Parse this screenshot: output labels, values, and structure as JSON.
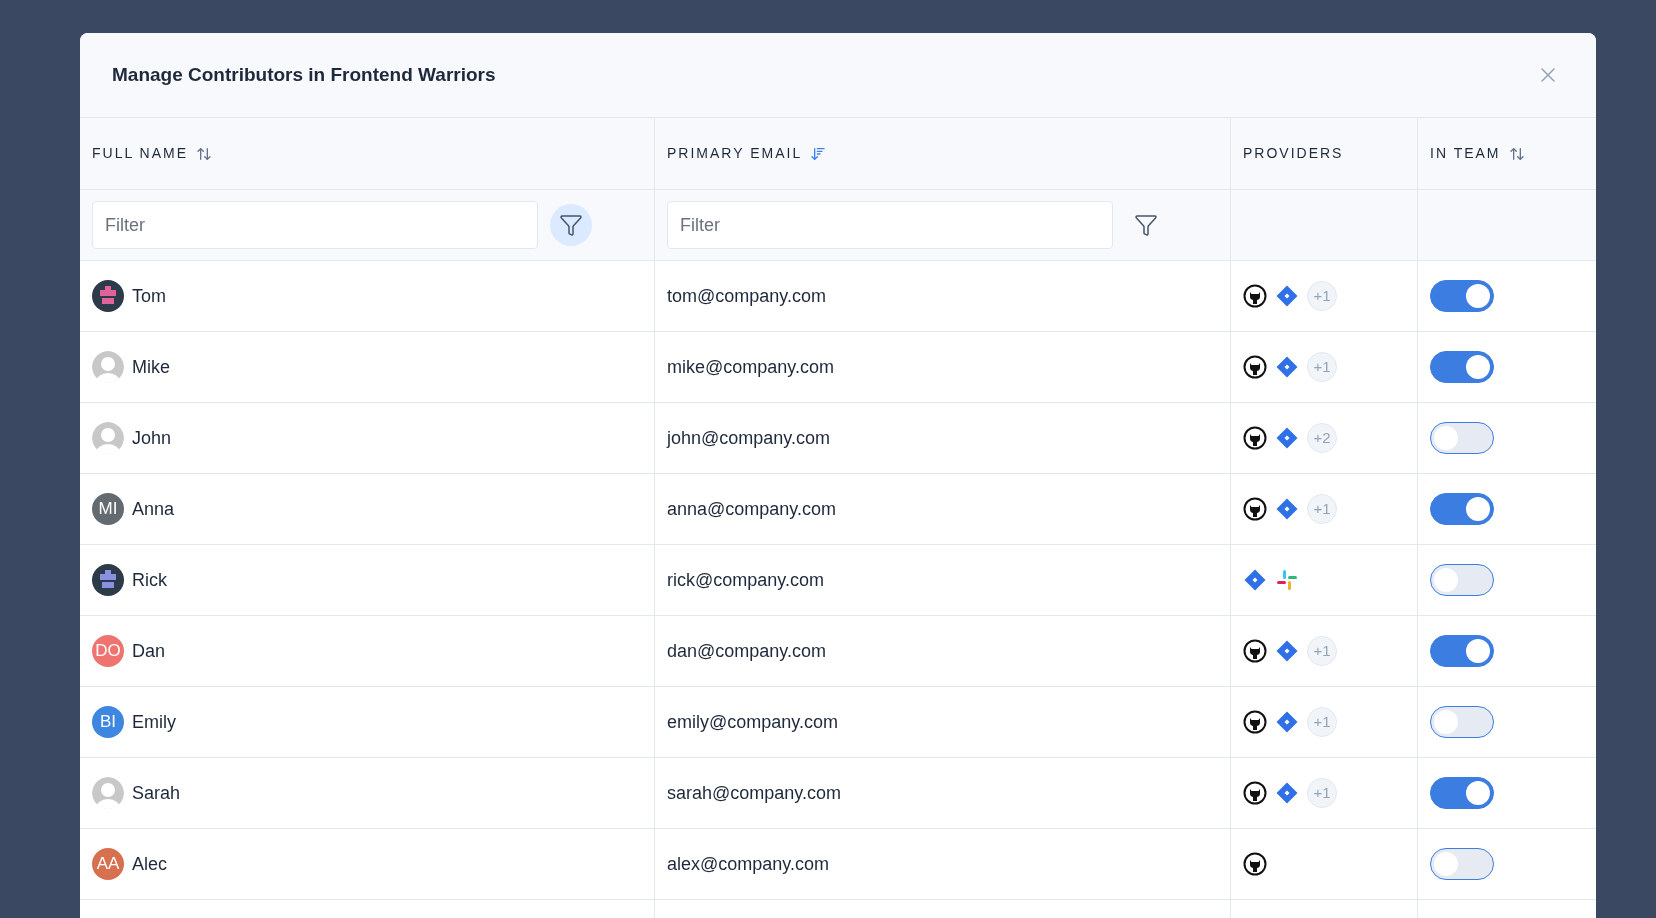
{
  "modal": {
    "title": "Manage Contributors in Frontend Warriors"
  },
  "columns": [
    {
      "label": "FULL NAME",
      "sort": {
        "kind": "unsorted"
      },
      "filter": {
        "placeholder": "Filter",
        "active": true
      }
    },
    {
      "label": "PRIMARY EMAIL",
      "sort": {
        "kind": "descending"
      },
      "filter": {
        "placeholder": "Filter",
        "active": false
      }
    },
    {
      "label": "PROVIDERS"
    },
    {
      "label": "IN TEAM",
      "sort": {
        "kind": "unsorted"
      }
    }
  ],
  "rows": [
    {
      "name": "Tom",
      "avatar": {
        "kind": "pixel",
        "color": "#e0649a"
      },
      "email": "tom@company.com",
      "providers": [
        {
          "kind": "github"
        },
        {
          "kind": "jira"
        }
      ],
      "more": "+1",
      "in_team": true
    },
    {
      "name": "Mike",
      "avatar": {
        "kind": "default"
      },
      "email": "mike@company.com",
      "providers": [
        {
          "kind": "github"
        },
        {
          "kind": "jira"
        }
      ],
      "more": "+1",
      "in_team": true
    },
    {
      "name": "John",
      "avatar": {
        "kind": "default"
      },
      "email": "john@company.com",
      "providers": [
        {
          "kind": "github"
        },
        {
          "kind": "jira"
        }
      ],
      "more": "+2",
      "in_team": false
    },
    {
      "name": "Anna",
      "avatar": {
        "kind": "initials",
        "initials": "MI",
        "color": "#646b70"
      },
      "email": "anna@company.com",
      "providers": [
        {
          "kind": "github"
        },
        {
          "kind": "jira"
        }
      ],
      "more": "+1",
      "in_team": true
    },
    {
      "name": "Rick",
      "avatar": {
        "kind": "pixel",
        "color": "#8b8fe0"
      },
      "email": "rick@company.com",
      "providers": [
        {
          "kind": "jira"
        },
        {
          "kind": "slack"
        }
      ],
      "in_team": false
    },
    {
      "name": "Dan",
      "avatar": {
        "kind": "initials",
        "initials": "DO",
        "color": "#ef7470"
      },
      "email": "dan@company.com",
      "providers": [
        {
          "kind": "github"
        },
        {
          "kind": "jira"
        }
      ],
      "more": "+1",
      "in_team": true
    },
    {
      "name": "Emily",
      "avatar": {
        "kind": "initials",
        "initials": "BI",
        "color": "#3d87e0"
      },
      "email": "emily@company.com",
      "providers": [
        {
          "kind": "github"
        },
        {
          "kind": "jira"
        }
      ],
      "more": "+1",
      "in_team": false
    },
    {
      "name": "Sarah",
      "avatar": {
        "kind": "default"
      },
      "email": "sarah@company.com",
      "providers": [
        {
          "kind": "github"
        },
        {
          "kind": "jira"
        }
      ],
      "more": "+1",
      "in_team": true
    },
    {
      "name": "Alec",
      "avatar": {
        "kind": "initials",
        "initials": "AA",
        "color": "#d6704f"
      },
      "email": "alex@company.com",
      "providers": [
        {
          "kind": "github"
        }
      ],
      "in_team": false
    }
  ]
}
